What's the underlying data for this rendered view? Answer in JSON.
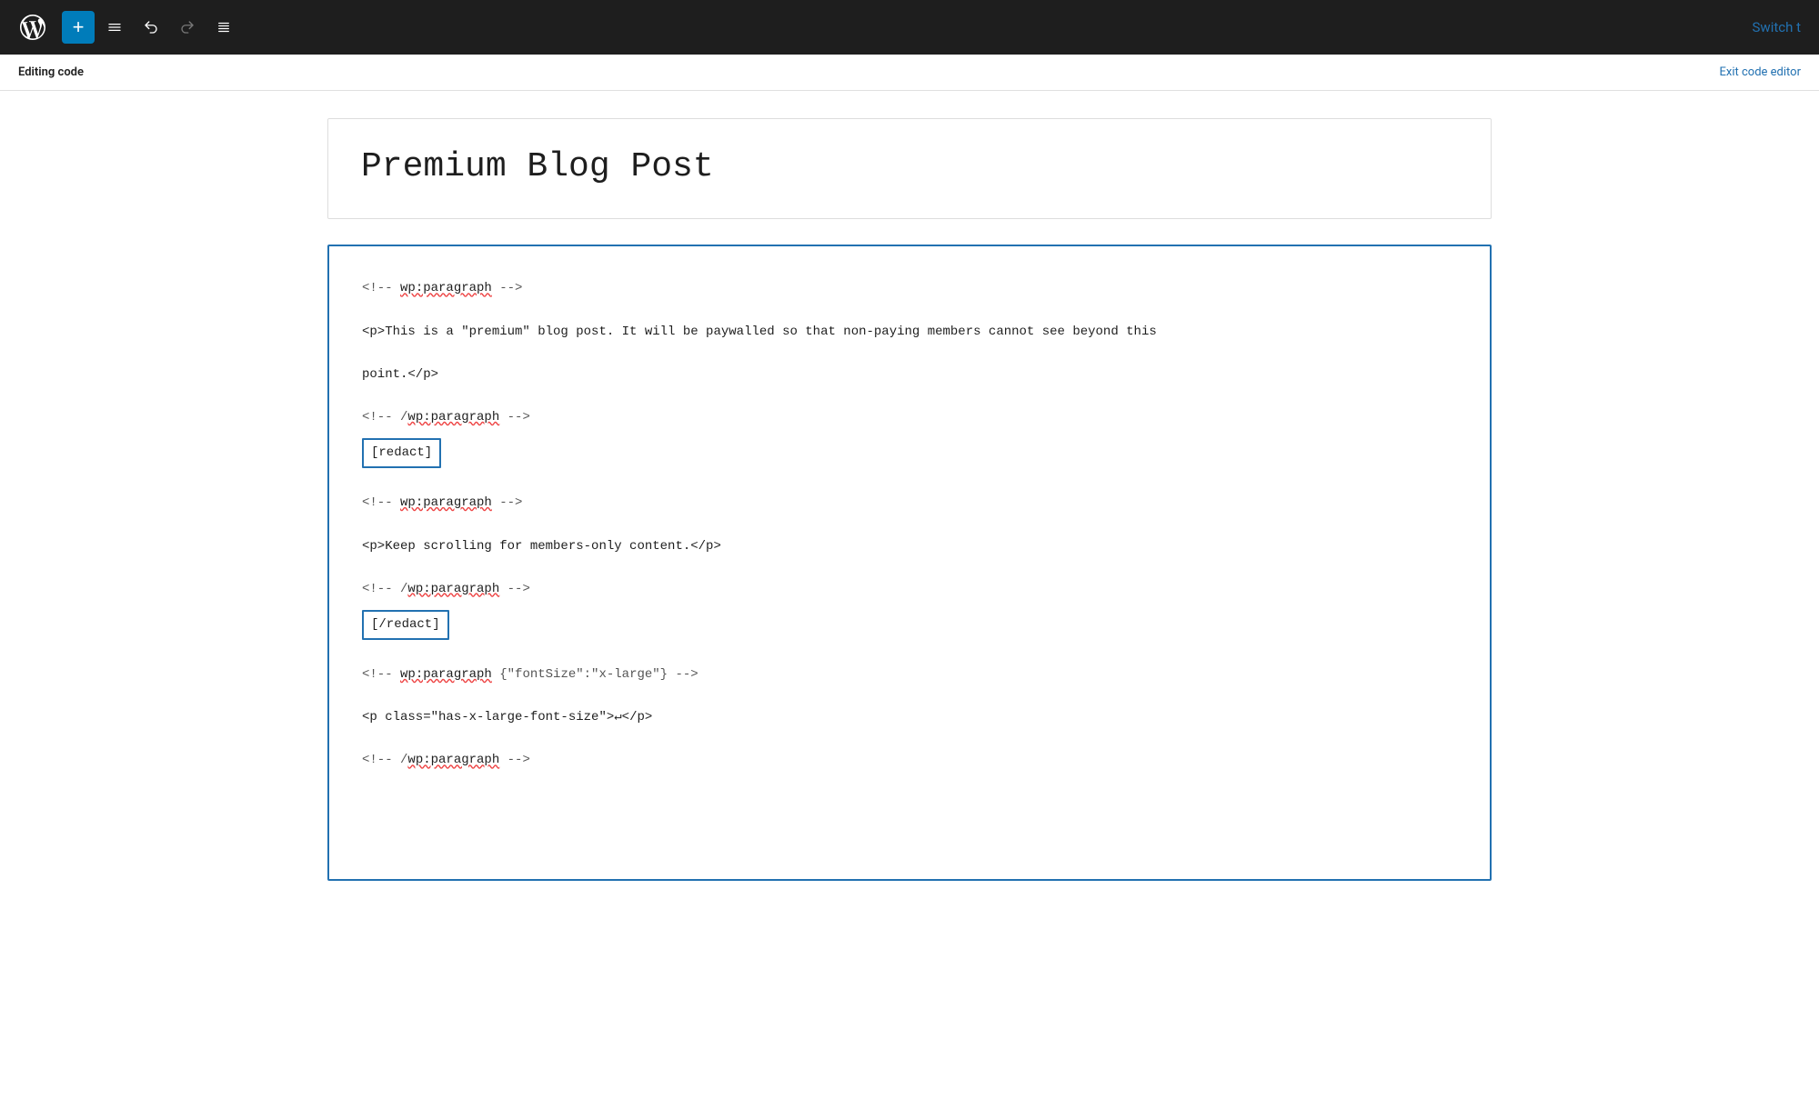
{
  "toolbar": {
    "add_label": "+",
    "switch_label": "Switch t"
  },
  "editing_bar": {
    "label": "Editing code",
    "exit_label": "Exit code editor"
  },
  "post": {
    "title": "Premium Blog Post"
  },
  "code_editor": {
    "lines": [
      {
        "type": "comment",
        "text": "<!-- ",
        "tag": "wp:paragraph",
        "end": " -->"
      },
      {
        "type": "blank"
      },
      {
        "type": "code",
        "text": "<p>This is a \"premium\" blog post. It will be paywalled so that non-paying members cannot see beyond this"
      },
      {
        "type": "blank"
      },
      {
        "type": "code",
        "text": "point.</p>"
      },
      {
        "type": "blank"
      },
      {
        "type": "comment",
        "text": "<!-- /",
        "tag": "wp:paragraph",
        "end": " -->"
      },
      {
        "type": "shortcode",
        "text": "[redact]"
      },
      {
        "type": "blank"
      },
      {
        "type": "comment",
        "text": "<!-- ",
        "tag": "wp:paragraph",
        "end": " -->"
      },
      {
        "type": "blank"
      },
      {
        "type": "code",
        "text": "<p>Keep scrolling for members-only content.</p>"
      },
      {
        "type": "blank"
      },
      {
        "type": "comment",
        "text": "<!-- /",
        "tag": "wp:paragraph",
        "end": " -->"
      },
      {
        "type": "shortcode",
        "text": "[/redact]"
      },
      {
        "type": "blank"
      },
      {
        "type": "comment",
        "text": "<!-- ",
        "tag": "wp:paragraph",
        "end_extra": " {\"fontSize\":\"x-large\"} -->"
      },
      {
        "type": "blank"
      },
      {
        "type": "code",
        "text": "<p class=\"has-x-large-font-size\">↵</p>"
      },
      {
        "type": "blank"
      },
      {
        "type": "comment",
        "text": "<!-- /",
        "tag": "wp:paragraph",
        "end": " -->"
      }
    ]
  }
}
